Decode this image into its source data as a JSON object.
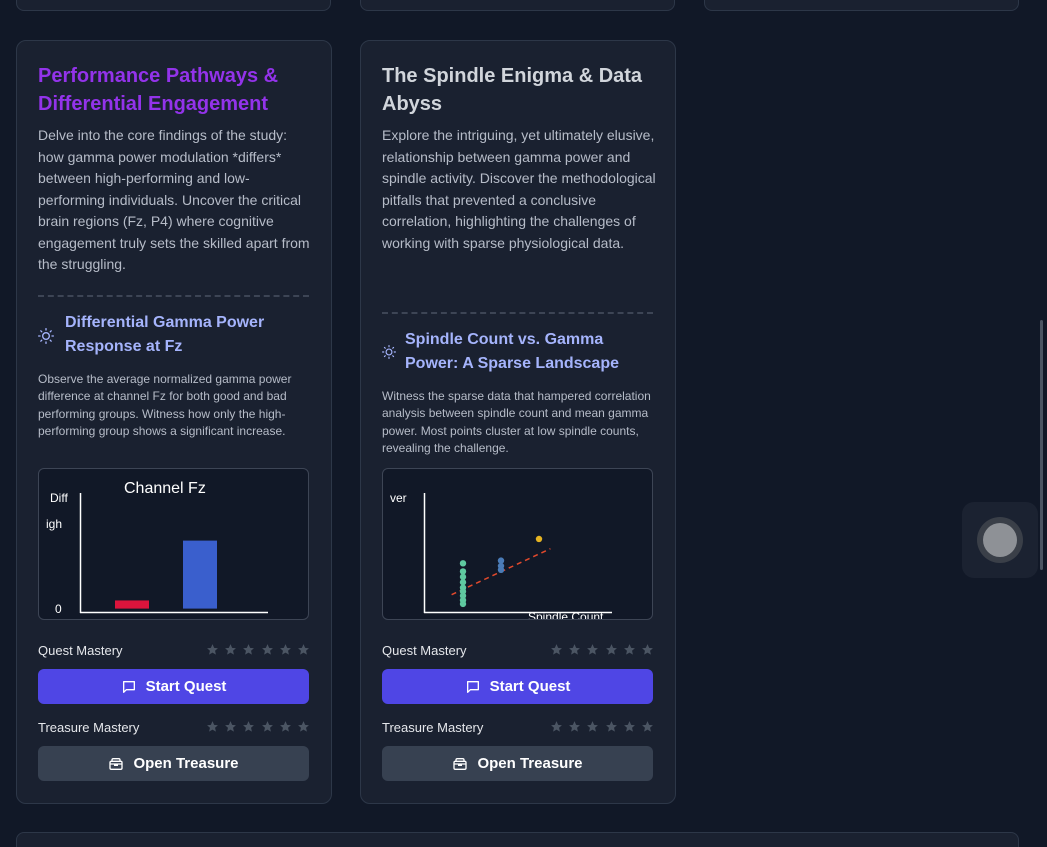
{
  "colors": {
    "title_purple": "#9333ea",
    "title_gray": "#d1d5db",
    "accent_indigo": "#a5b4fc",
    "button_primary": "#4f46e5",
    "button_secondary": "#374151",
    "bar_red": "#dc143c",
    "bar_blue": "#3a5fcd"
  },
  "cards": [
    {
      "title": "Performance Pathways & Differential Engagement",
      "description": "Delve into the core findings of the study: how gamma power modulation *differs* between high-performing and low-performing individuals. Uncover the critical brain regions (Fz, P4) where cognitive engagement truly sets the skilled apart from the struggling.",
      "section_icon": "sun-icon",
      "section_title": "Differential Gamma Power Response at Fz",
      "section_description": "Observe the average normalized gamma power difference at channel Fz for both good and bad performing groups. Witness how only the high-performing group shows a significant increase.",
      "quest_mastery_label": "Quest Mastery",
      "quest_stars": 0,
      "start_quest_label": "Start Quest",
      "treasure_mastery_label": "Treasure Mastery",
      "treasure_stars": 0,
      "open_treasure_label": "Open Treasure"
    },
    {
      "title": "The Spindle Enigma & Data Abyss",
      "description": "Explore the intriguing, yet ultimately elusive, relationship between gamma power and spindle activity. Discover the methodological pitfalls that prevented a conclusive correlation, highlighting the challenges of working with sparse physiological data.",
      "section_icon": "sun-icon",
      "section_title": "Spindle Count vs. Gamma Power: A Sparse Landscape",
      "section_description": "Witness the sparse data that hampered correlation analysis between spindle count and mean gamma power. Most points cluster at low spindle counts, revealing the challenge.",
      "quest_mastery_label": "Quest Mastery",
      "quest_stars": 0,
      "start_quest_label": "Start Quest",
      "treasure_mastery_label": "Treasure Mastery",
      "treasure_stars": 0,
      "open_treasure_label": "Open Treasure"
    }
  ],
  "chart_data": [
    {
      "type": "bar",
      "title": "Channel Fz",
      "ylabel_fragments": [
        "Diff",
        "igh"
      ],
      "y_tick_labels": [
        "0"
      ],
      "series": [
        {
          "values": [
            0.12,
            1.0
          ]
        }
      ],
      "bar_colors": [
        "#dc143c",
        "#3a5fcd"
      ],
      "ylim": [
        -0.05,
        1.7
      ],
      "grid": false
    },
    {
      "type": "scatter",
      "xlabel": "Spindle Count",
      "ylabel_fragment": "ver",
      "series": [
        {
          "color": "#5fc9a0",
          "points": [
            [
              1,
              0.8
            ],
            [
              1,
              0.65
            ],
            [
              1,
              0.55
            ],
            [
              1,
              0.45
            ],
            [
              1,
              0.35
            ],
            [
              1,
              0.28
            ],
            [
              1,
              0.2
            ],
            [
              1,
              0.12
            ],
            [
              1,
              0.05
            ]
          ]
        },
        {
          "color": "#4a7bb7",
          "points": [
            [
              2,
              0.85
            ],
            [
              2,
              0.75
            ],
            [
              2,
              0.68
            ]
          ]
        },
        {
          "color": "#e6b422",
          "points": [
            [
              3,
              1.25
            ]
          ]
        }
      ],
      "trendline": {
        "color": "#e2492c",
        "style": "dashed",
        "from": [
          0.7,
          0.22
        ],
        "to": [
          3.3,
          1.07
        ]
      },
      "xlim": [
        0,
        6
      ],
      "ylim": [
        -0.1,
        2.1
      ],
      "grid": false
    }
  ]
}
